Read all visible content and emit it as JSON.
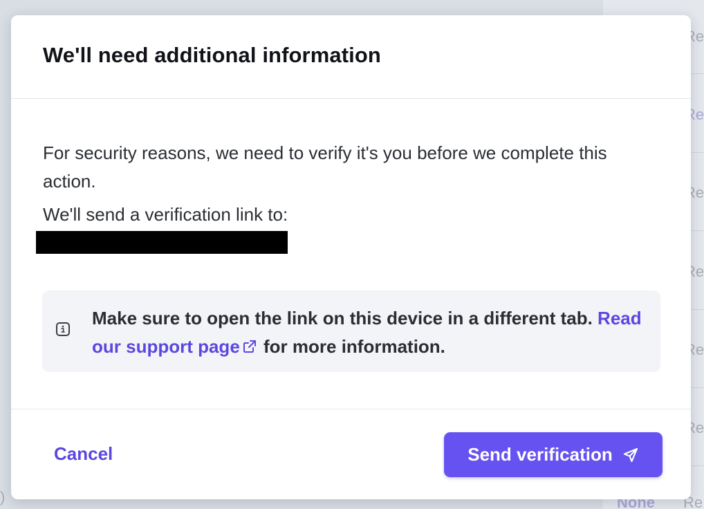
{
  "dialog": {
    "title": "We'll need additional information",
    "body_line1": "For security reasons, we need to verify it's you before we complete this action.",
    "body_line2": "We'll send a verification link to:",
    "info": {
      "icon": "info-icon",
      "text_before": "Make sure to open the link on this device in a different tab.",
      "link_label": "Read our support page",
      "link_icon": "external-link-icon",
      "text_after": "for more information."
    },
    "cancel_label": "Cancel",
    "send_label": "Send verification",
    "send_icon": "send-icon"
  },
  "background": {
    "column_glyphs": [
      "Re",
      "Re",
      "Re",
      "Re",
      "Re",
      "Re"
    ],
    "bottom_link": "None",
    "bottom_text": "Re"
  },
  "colors": {
    "accent": "#6652f0",
    "link": "#5b47e0",
    "info_background": "#f3f4f7"
  }
}
